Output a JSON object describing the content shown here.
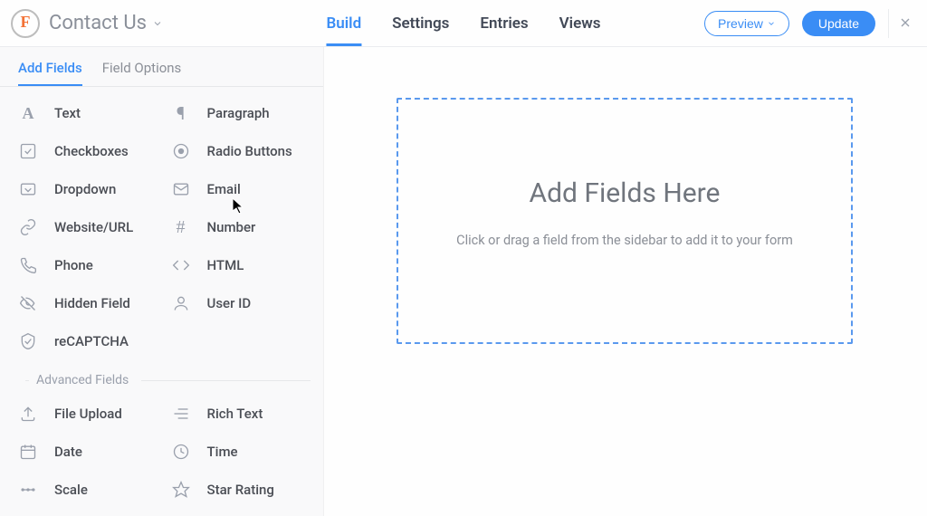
{
  "header": {
    "form_title": "Contact Us",
    "nav": {
      "build": "Build",
      "settings": "Settings",
      "entries": "Entries",
      "views": "Views"
    },
    "preview": "Preview",
    "update": "Update"
  },
  "sidebar": {
    "tabs": {
      "add_fields": "Add Fields",
      "field_options": "Field Options"
    },
    "basic_fields": [
      {
        "label": "Text",
        "icon": "text-icon"
      },
      {
        "label": "Paragraph",
        "icon": "paragraph-icon"
      },
      {
        "label": "Checkboxes",
        "icon": "checkbox-icon"
      },
      {
        "label": "Radio Buttons",
        "icon": "radio-icon"
      },
      {
        "label": "Dropdown",
        "icon": "dropdown-icon"
      },
      {
        "label": "Email",
        "icon": "email-icon"
      },
      {
        "label": "Website/URL",
        "icon": "link-icon"
      },
      {
        "label": "Number",
        "icon": "number-icon"
      },
      {
        "label": "Phone",
        "icon": "phone-icon"
      },
      {
        "label": "HTML",
        "icon": "html-icon"
      },
      {
        "label": "Hidden Field",
        "icon": "hidden-icon"
      },
      {
        "label": "User ID",
        "icon": "user-icon"
      },
      {
        "label": "reCAPTCHA",
        "icon": "shield-icon"
      }
    ],
    "advanced_header": "Advanced Fields",
    "advanced_fields": [
      {
        "label": "File Upload",
        "icon": "upload-icon"
      },
      {
        "label": "Rich Text",
        "icon": "richtext-icon"
      },
      {
        "label": "Date",
        "icon": "calendar-icon"
      },
      {
        "label": "Time",
        "icon": "clock-icon"
      },
      {
        "label": "Scale",
        "icon": "scale-icon"
      },
      {
        "label": "Star Rating",
        "icon": "star-icon"
      }
    ]
  },
  "canvas": {
    "dropzone_title": "Add Fields Here",
    "dropzone_sub": "Click or drag a field from the sidebar to add it to your form"
  }
}
